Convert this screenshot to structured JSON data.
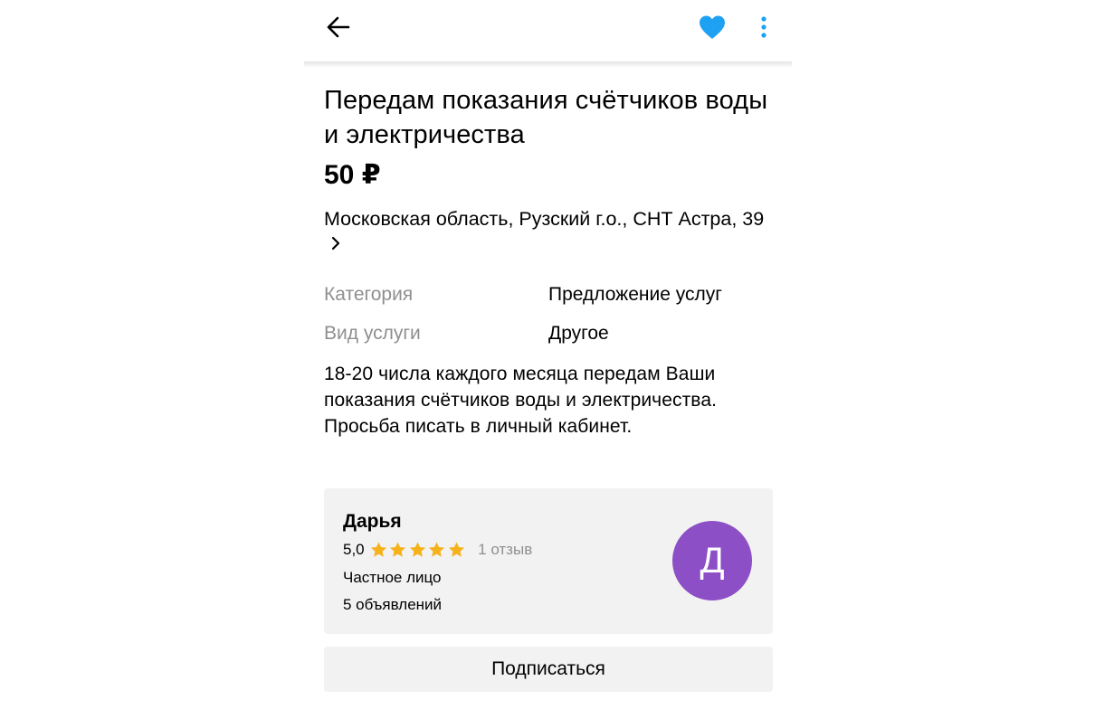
{
  "header": {
    "back_icon": "arrow-left-icon",
    "favorite_icon": "heart-icon",
    "favorite_color": "#1ea1f2",
    "more_icon": "more-vertical-icon"
  },
  "listing": {
    "title": "Передам показания счётчиков воды и электричества",
    "price": "50 ₽",
    "address": "Московская область, Рузский г.о., СНТ Астра, 39",
    "address_icon": "chevron-right-icon",
    "params": [
      {
        "name": "Категория",
        "value": "Предложение услуг"
      },
      {
        "name": "Вид услуги",
        "value": "Другое"
      }
    ],
    "description": "18-20 числа каждого месяца передам Ваши показания счётчиков воды и электричества. Просьба писать в личный кабинет."
  },
  "seller": {
    "name": "Дарья",
    "rating": "5,0",
    "stars": 5,
    "star_color": "#f5b21b",
    "reviews": "1 отзыв",
    "type": "Частное лицо",
    "ads_count": "5 объявлений",
    "avatar_letter": "Д",
    "avatar_color": "#8d4fc5"
  },
  "actions": {
    "subscribe_label": "Подписаться"
  }
}
